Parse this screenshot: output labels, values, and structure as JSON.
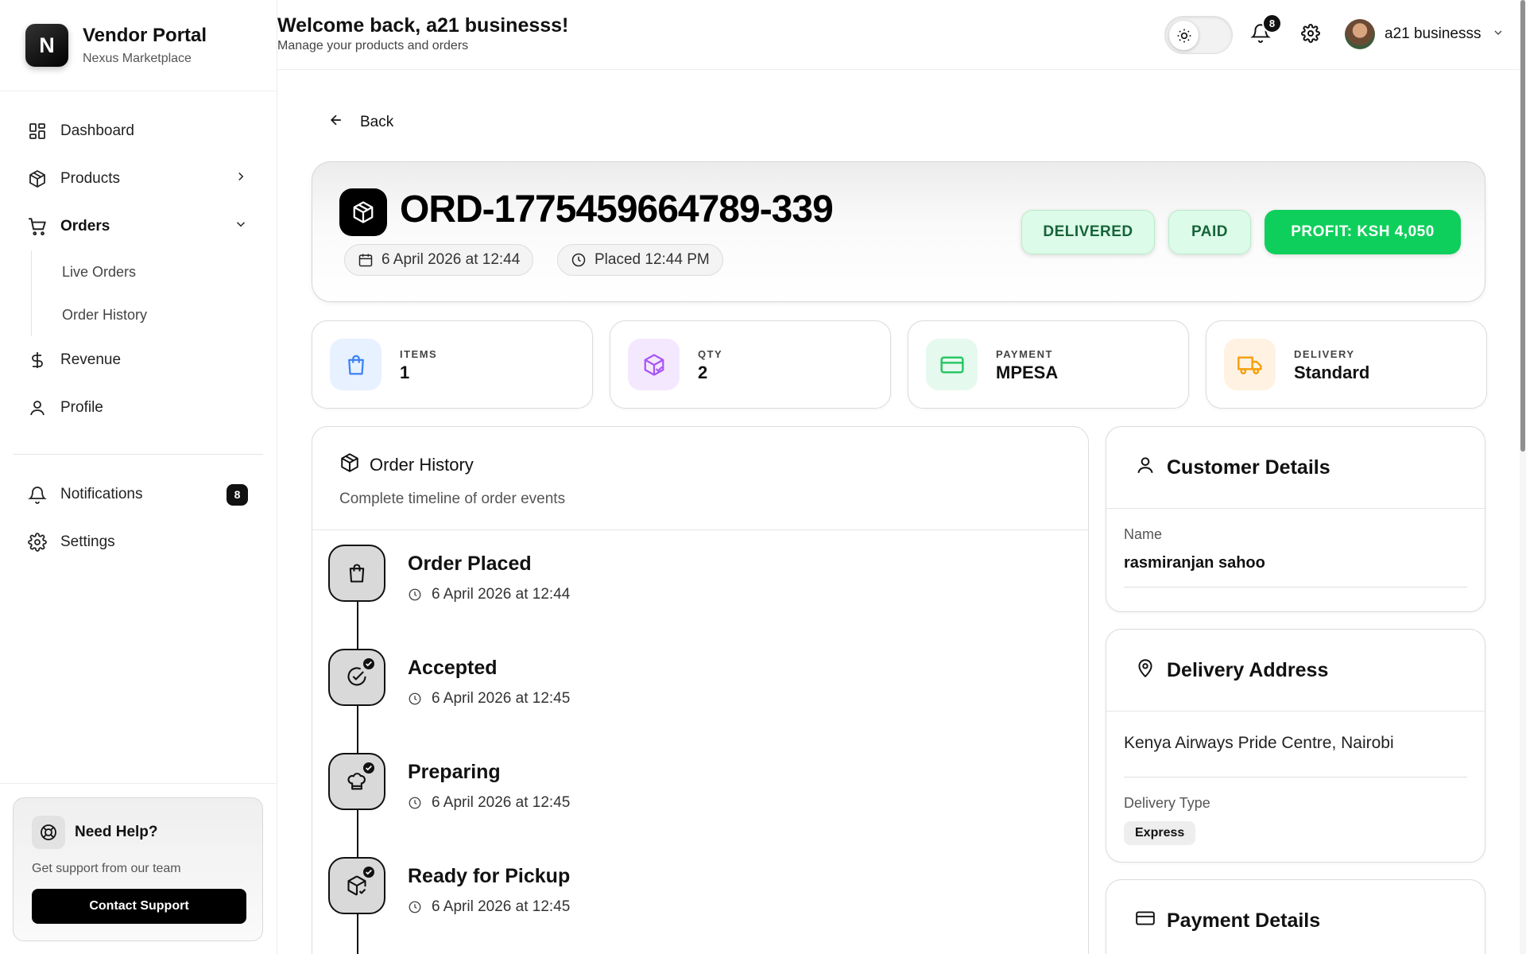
{
  "brand": {
    "logo_letter": "N",
    "title": "Vendor Portal",
    "subtitle": "Nexus Marketplace"
  },
  "nav": {
    "dashboard": "Dashboard",
    "products": "Products",
    "orders": "Orders",
    "orders_sub": [
      "Live Orders",
      "Order History"
    ],
    "revenue": "Revenue",
    "profile": "Profile",
    "notifications": "Notifications",
    "notifications_count": "8",
    "settings": "Settings"
  },
  "help": {
    "title": "Need Help?",
    "subtitle": "Get support from our team",
    "button": "Contact Support"
  },
  "header": {
    "welcome": "Welcome back, a21 businesss!",
    "subtitle": "Manage your products and orders",
    "notification_count": "8",
    "user_name": "a21 businesss"
  },
  "back_label": "Back",
  "order": {
    "id": "ORD-1775459664789-339",
    "date_chip": "6 April 2026 at 12:44",
    "placed_chip": "Placed 12:44 PM",
    "status_delivery": "DELIVERED",
    "status_payment": "PAID",
    "profit": "PROFIT: KSH 4,050"
  },
  "stats": [
    {
      "label": "ITEMS",
      "value": "1",
      "icon": "shopping-bag-icon",
      "bg": "#e8f1ff",
      "color": "#3b82f6"
    },
    {
      "label": "QTY",
      "value": "2",
      "icon": "package-check-icon",
      "bg": "#f4e8ff",
      "color": "#a855f7"
    },
    {
      "label": "PAYMENT",
      "value": "MPESA",
      "icon": "credit-card-icon",
      "bg": "#e6f9ee",
      "color": "#22c55e"
    },
    {
      "label": "DELIVERY",
      "value": "Standard",
      "icon": "truck-icon",
      "bg": "#fff2e2",
      "color": "#f59e0b"
    }
  ],
  "history": {
    "title": "Order History",
    "subtitle": "Complete timeline of order events",
    "events": [
      {
        "title": "Order Placed",
        "time": "6 April 2026 at 12:44",
        "icon": "shopping-bag-icon",
        "checked": false
      },
      {
        "title": "Accepted",
        "time": "6 April 2026 at 12:45",
        "icon": "check-circle-icon",
        "checked": true
      },
      {
        "title": "Preparing",
        "time": "6 April 2026 at 12:45",
        "icon": "chef-hat-icon",
        "checked": true
      },
      {
        "title": "Ready for Pickup",
        "time": "6 April 2026 at 12:45",
        "icon": "package-check-icon",
        "checked": true
      }
    ]
  },
  "customer": {
    "title": "Customer Details",
    "name_label": "Name",
    "name": "rasmiranjan sahoo"
  },
  "delivery": {
    "title": "Delivery Address",
    "address": "Kenya Airways Pride Centre, Nairobi",
    "type_label": "Delivery Type",
    "type": "Express"
  },
  "payment": {
    "title": "Payment Details"
  },
  "colors": {
    "profit_green": "#0fcf5c",
    "status_green_bg": "#dcfbe8",
    "status_green_text": "#17643a"
  }
}
